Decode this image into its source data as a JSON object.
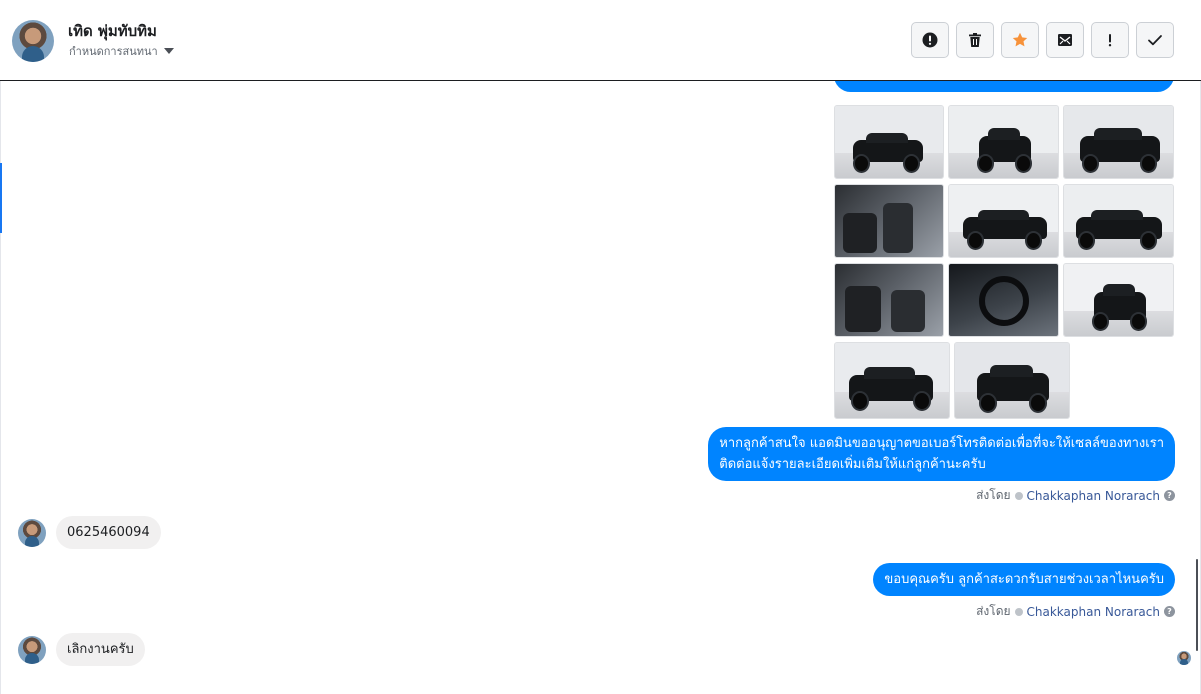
{
  "header": {
    "contact_name": "เทิด พุ่มทับทิม",
    "assign_label": "กำหนดการสนทนา",
    "toolbar": [
      {
        "name": "spam-button",
        "icon": "alert-circle-icon"
      },
      {
        "name": "delete-button",
        "icon": "trash-icon"
      },
      {
        "name": "star-button",
        "icon": "star-icon"
      },
      {
        "name": "mark-unread-button",
        "icon": "envelope-icon"
      },
      {
        "name": "flag-button",
        "icon": "exclamation-icon"
      },
      {
        "name": "done-button",
        "icon": "checkmark-icon"
      }
    ]
  },
  "thread": {
    "outgoing_1": "หากลูกค้าสนใจ แอดมินขออนุญาตขอเบอร์โทรติดต่อเพื่อที่จะให้เซลล์ของทางเรา",
    "outgoing_1b": "ติดต่อแจ้งรายละเอียดเพิ่มเติมให้แก่ลูกค้านะครับ",
    "sent_by_label": "ส่งโดย",
    "agent_name": "Chakkaphan Norarach",
    "incoming_1": "0625460094",
    "outgoing_2": "ขอบคุณครับ ลูกค้าสะดวกรับสายช่วงเวลาไหนครับ",
    "incoming_2": "เลิกงานครับ",
    "help_glyph": "?"
  },
  "colors": {
    "outgoing_bubble": "#0084ff",
    "incoming_bubble": "#f1f0f0",
    "star": "#f7923a",
    "link": "#385898"
  }
}
